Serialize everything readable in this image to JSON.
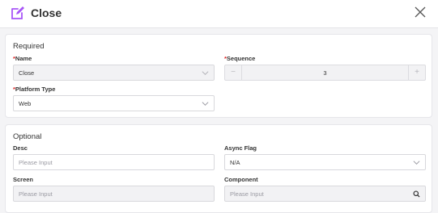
{
  "dialog": {
    "title": "Close",
    "title_icon": "edit-icon",
    "close_icon": "close-icon",
    "accent_color": "#a855f7"
  },
  "required": {
    "heading": "Required",
    "name": {
      "label": "Name",
      "value": "Close",
      "required_mark": "*"
    },
    "sequence": {
      "label": "Sequence",
      "value": "3",
      "required_mark": "*",
      "minus": "−",
      "plus": "+"
    },
    "platform_type": {
      "label": "Platform Type",
      "value": "Web",
      "required_mark": "*"
    }
  },
  "optional": {
    "heading": "Optional",
    "desc": {
      "label": "Desc",
      "placeholder": "Please Input"
    },
    "async_flag": {
      "label": "Async Flag",
      "value": "N/A"
    },
    "screen": {
      "label": "Screen",
      "placeholder": "Please Input"
    },
    "component": {
      "label": "Component",
      "placeholder": "Please Input"
    }
  }
}
